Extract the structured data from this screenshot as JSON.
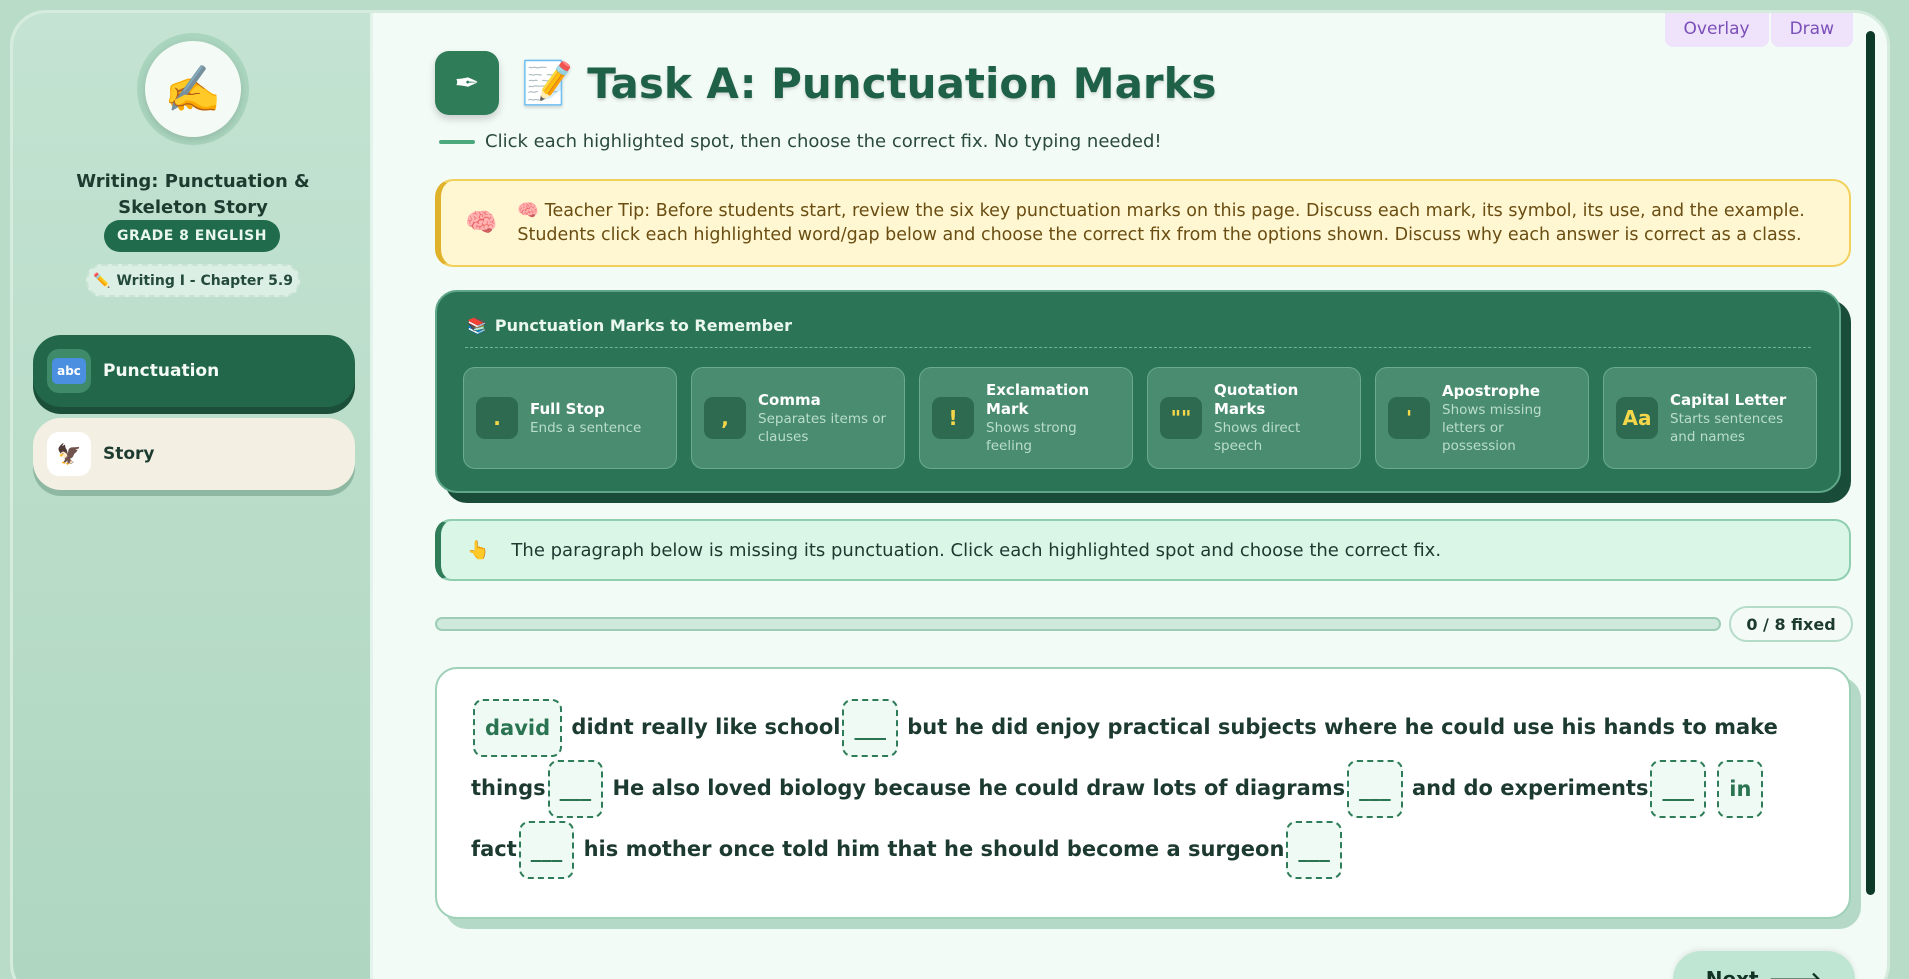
{
  "tools": {
    "overlay_label": "Overlay",
    "draw_label": "Draw"
  },
  "sidebar": {
    "logo_emoji": "✍️",
    "course_title": "Writing: Punctuation & Skeleton Story",
    "grade": "GRADE 8 ENGLISH",
    "chapter_emoji": "✏️",
    "chapter": "Writing I - Chapter 5.9",
    "nav": [
      {
        "label": "Punctuation",
        "icon": "abc-icon",
        "icon_text": "abc",
        "active": true
      },
      {
        "label": "Story",
        "icon": "eagle-icon",
        "icon_text": "🦅",
        "active": false
      }
    ]
  },
  "main": {
    "title_icon": "✒",
    "title_emoji": "📝",
    "title": "Task A: Punctuation Marks",
    "subtitle": "Click each highlighted spot, then choose the correct fix. No typing needed!",
    "tip_icon": "🧠",
    "tip": "🧠 Teacher Tip: Before students start, review the six key punctuation marks on this page. Discuss each mark, its symbol, its use, and the example. Students click each highlighted word/gap below and choose the correct fix from the options shown. Discuss why each answer is correct as a class.",
    "marks_title": "Punctuation Marks to Remember",
    "marks_emoji": "📚",
    "marks": [
      {
        "symbol": ".",
        "name": "Full Stop",
        "desc": "Ends a sentence"
      },
      {
        "symbol": ",",
        "name": "Comma",
        "desc": "Separates items or clauses"
      },
      {
        "symbol": "!",
        "name": "Exclamation Mark",
        "desc": "Shows strong feeling"
      },
      {
        "symbol": "\"\"",
        "name": "Quotation Marks",
        "desc": "Shows direct speech"
      },
      {
        "symbol": "'",
        "name": "Apostrophe",
        "desc": "Shows missing letters or possession"
      },
      {
        "symbol": "Aa",
        "name": "Capital Letter",
        "desc": "Starts sentences and names"
      }
    ],
    "instruction_icon": "👆",
    "instruction": "The paragraph below is missing its punctuation. Click each highlighted spot and choose the correct fix.",
    "progress": {
      "fixed": 0,
      "total": 8,
      "label": "0 / 8 fixed"
    },
    "paragraph": {
      "s1": "david",
      "t1": " didnt really like school",
      "s2": "___",
      "t2": " but he did enjoy practical subjects where he could use his hands to make things",
      "s3": "___",
      "t3": " He also loved biology because he could draw lots of diagrams",
      "s4": "___",
      "t4": " and do experiments",
      "s5": "___",
      "s6": "in",
      "t5": " fact",
      "s7": "___",
      "t6": " his mother once told him that he should become a surgeon",
      "s8": "___"
    },
    "next_label": "Next",
    "next_arrow": "🡒"
  }
}
